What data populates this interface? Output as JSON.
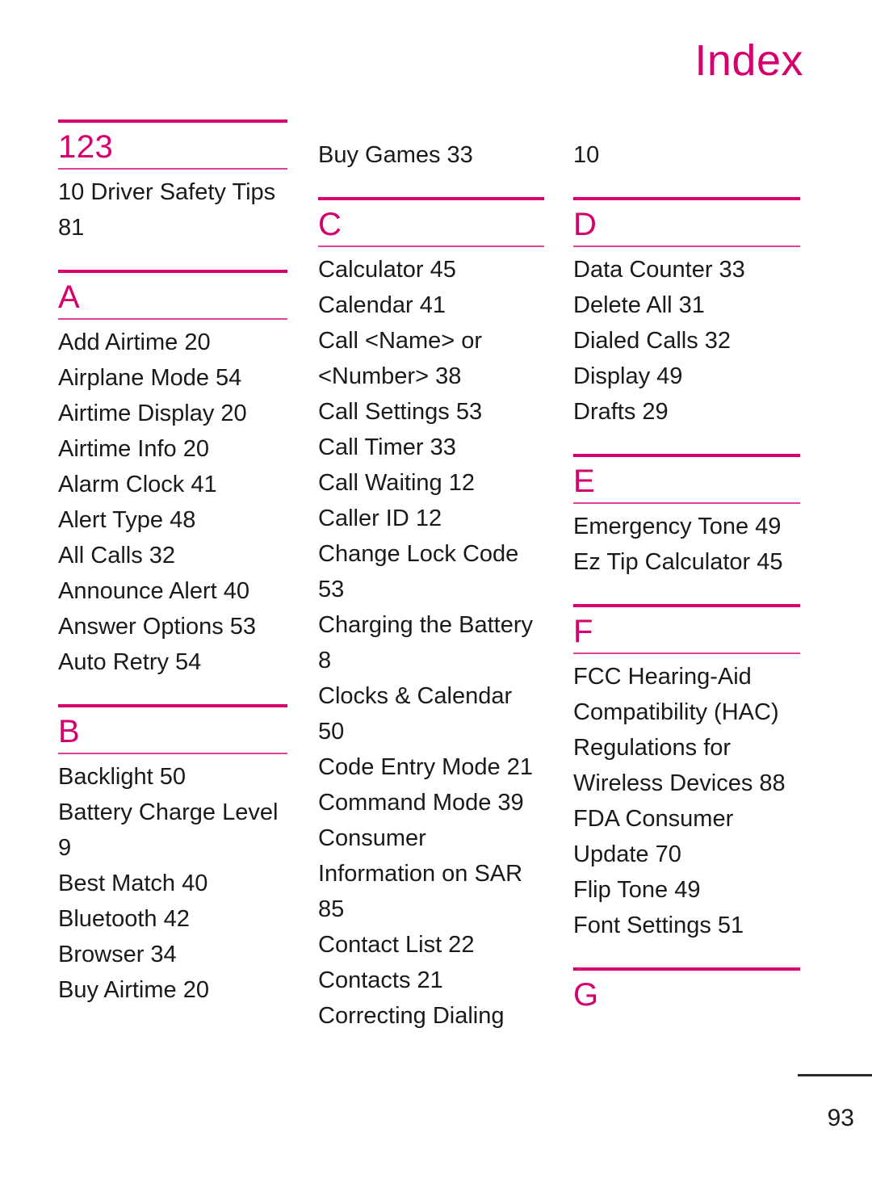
{
  "page": {
    "title": "Index",
    "number": "93",
    "accent_color": "#d5006d",
    "rule_thick_color": "#d5006d",
    "rule_thin_color": "#e0439a",
    "text_color": "#1a1a1a",
    "background_color": "#ffffff"
  },
  "columns": [
    {
      "id": "column-1",
      "blocks": [
        {
          "type": "section",
          "letter": "123",
          "entries": [
            "10 Driver Safety Tips 81"
          ]
        },
        {
          "type": "section",
          "letter": "A",
          "entries": [
            "Add Airtime 20",
            "Airplane Mode 54",
            "Airtime Display 20",
            "Airtime Info 20",
            "Alarm Clock 41",
            "Alert Type 48",
            "All Calls 32",
            "Announce Alert 40",
            "Answer Options 53",
            "Auto Retry 54"
          ]
        },
        {
          "type": "section",
          "letter": "B",
          "entries": [
            "Backlight 50",
            "Battery Charge Level 9",
            "Best Match 40",
            "Bluetooth 42",
            "Browser 34",
            "Buy Airtime 20"
          ]
        }
      ]
    },
    {
      "id": "column-2",
      "blocks": [
        {
          "type": "continuation",
          "entries": [
            "Buy Games 33"
          ]
        },
        {
          "type": "section",
          "letter": "C",
          "entries": [
            "Calculator 45",
            "Calendar 41",
            "Call <Name> or <Number> 38",
            "Call Settings 53",
            "Call Timer 33",
            "Call Waiting 12",
            "Caller ID 12",
            "Change Lock Code 53",
            "Charging the Battery 8",
            "Clocks & Calendar 50",
            "Code Entry Mode 21",
            "Command Mode 39",
            "Consumer Information on SAR 85",
            "Contact List 22",
            "Contacts 21",
            "Correcting Dialing"
          ]
        }
      ]
    },
    {
      "id": "column-3",
      "blocks": [
        {
          "type": "continuation",
          "entries": [
            "10"
          ]
        },
        {
          "type": "section",
          "letter": "D",
          "entries": [
            "Data Counter 33",
            "Delete All 31",
            "Dialed Calls 32",
            "Display 49",
            "Drafts 29"
          ]
        },
        {
          "type": "section",
          "letter": "E",
          "entries": [
            "Emergency Tone 49",
            "Ez Tip Calculator 45"
          ]
        },
        {
          "type": "section",
          "letter": "F",
          "entries": [
            "FCC Hearing-Aid Compatibility (HAC) Regulations for Wireless Devices 88",
            "FDA Consumer Update 70",
            "Flip Tone 49",
            "Font Settings 51"
          ]
        },
        {
          "type": "section",
          "letter": "G",
          "no_thin_rule": true,
          "entries": []
        }
      ]
    }
  ]
}
